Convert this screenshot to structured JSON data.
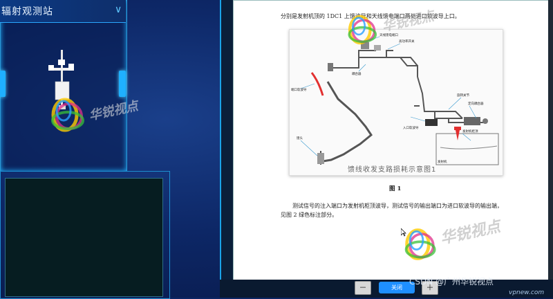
{
  "left_panel": {
    "title": "辐射观测站",
    "chevron": "chevron-down-icon"
  },
  "watermark": {
    "text": "华锐视点"
  },
  "document": {
    "line1": "分别是发射机顶的 1DC1 上馈波导和天线馈电端口两处进口软波导上口。",
    "diagram_caption": "馈线收发支路损耗示意图1",
    "figure_label": "图 1",
    "paragraph_a": "测试信号的注入端口为发射机柜顶波导，测试信号的输出端口为进口软波导的输出端，",
    "paragraph_b": "见图 2 绿色标注部分。"
  },
  "bottom_bar": {
    "zoom_out_glyph": "－",
    "zoom_in_glyph": "＋",
    "close_label": "关闭",
    "caption": "CSDN @广州华锐视点",
    "site": "vpnew.com"
  },
  "colors": {
    "accent": "#1fb0ff",
    "close_button": "#1e8fff",
    "panel_dark": "#061d21"
  }
}
